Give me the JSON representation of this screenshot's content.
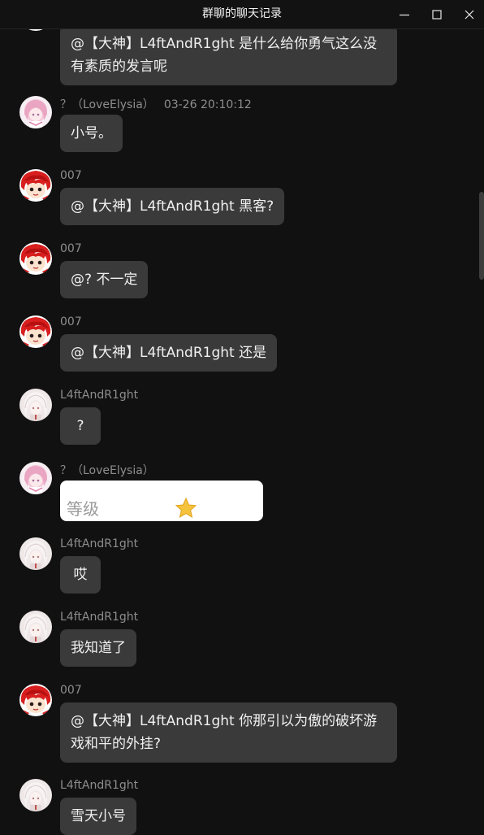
{
  "window": {
    "title": "群聊的聊天记录",
    "minimize_icon": "minimize-icon",
    "maximize_icon": "maximize-icon",
    "close_icon": "close-icon"
  },
  "messages": [
    {
      "avatar": "avatar-red-hair",
      "sender": "",
      "time": "",
      "text": "@【大神】L4ftAndR1ght 是什么给你勇气这么没有素质的发言呢"
    },
    {
      "avatar": "avatar-pink-hair",
      "sender": "？（LoveElysia）",
      "time": "03-26 20:10:12",
      "text": "小号。"
    },
    {
      "avatar": "avatar-red-hair",
      "sender": "007",
      "time": "",
      "text": "@【大神】L4ftAndR1ght 黑客?"
    },
    {
      "avatar": "avatar-red-hair",
      "sender": "007",
      "time": "",
      "text": "@? 不一定"
    },
    {
      "avatar": "avatar-red-hair",
      "sender": "007",
      "time": "",
      "text": "@【大神】L4ftAndR1ght 还是"
    },
    {
      "avatar": "avatar-white-hair",
      "sender": "L4ftAndR1ght",
      "time": "",
      "text": "?"
    },
    {
      "avatar": "avatar-pink-hair",
      "sender": "？（LoveElysia）",
      "time": "",
      "image_text": "等级",
      "image_icon": "star-icon"
    },
    {
      "avatar": "avatar-white-hair",
      "sender": "L4ftAndR1ght",
      "time": "",
      "text": "哎"
    },
    {
      "avatar": "avatar-white-hair",
      "sender": "L4ftAndR1ght",
      "time": "",
      "text": "我知道了"
    },
    {
      "avatar": "avatar-red-hair",
      "sender": "007",
      "time": "",
      "text": "@【大神】L4ftAndR1ght 你那引以为傲的破坏游戏和平的外挂?"
    },
    {
      "avatar": "avatar-white-hair",
      "sender": "L4ftAndR1ght",
      "time": "",
      "text": "雪天小号"
    }
  ]
}
